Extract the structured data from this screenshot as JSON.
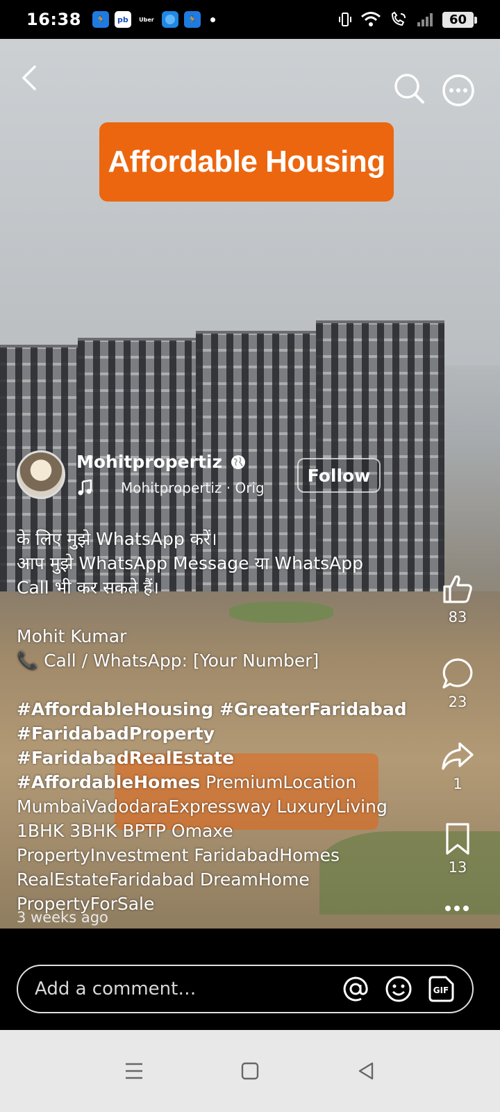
{
  "status_bar": {
    "time": "16:38",
    "apps": [
      "fitness-app",
      "pb",
      "Uber",
      "browser",
      "fitness-app"
    ],
    "battery": "60"
  },
  "video": {
    "banner_text": "Affordable Housing",
    "author": {
      "name": "Mohitpropertiz",
      "audio": "Mohitpropertiz · Orig"
    },
    "follow_label": "Follow",
    "caption_lines": [
      "के लिए मुझे WhatsApp करें।",
      "आप मुझे WhatsApp Message या WhatsApp",
      "Call भी कर सकते हैं।"
    ],
    "contact_name": "Mohit Kumar",
    "contact_line": "📞 Call / WhatsApp: [Your Number]",
    "hashtags_bold": [
      "#AffordableHousing #GreaterFaridabad",
      "#FaridabadProperty #FaridabadRealEstate",
      "#AffordableHomes"
    ],
    "tags_plain": [
      " PremiumLocation",
      "MumbaiVadodaraExpressway LuxuryLiving",
      "1BHK 3BHK BPTP Omaxe",
      "PropertyInvestment FaridabadHomes",
      "RealEstateFaridabad DreamHome",
      "PropertyForSale"
    ]
  },
  "actions": {
    "likes": "83",
    "comments": "23",
    "shares": "1",
    "saves": "13"
  },
  "timestamp": "3 weeks ago",
  "comment_box": {
    "placeholder": "Add a comment…",
    "gif_label": "GIF"
  },
  "colors": {
    "banner": "#ec660f",
    "background": "#000000",
    "nav_bar": "#e8e8e8"
  }
}
